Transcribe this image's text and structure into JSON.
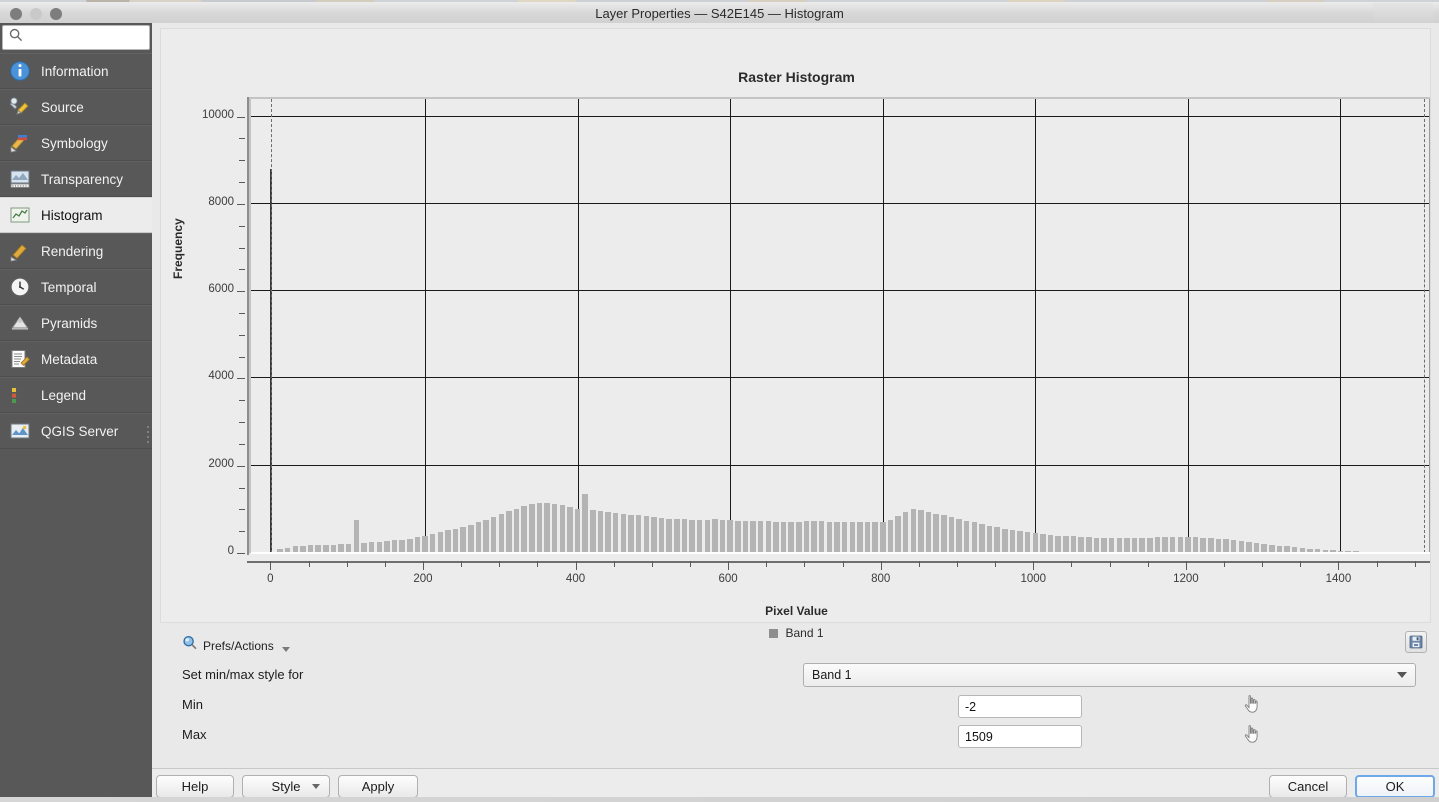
{
  "window": {
    "title": "Layer Properties — S42E145 — Histogram",
    "controls": [
      "close",
      "minimize",
      "maximize"
    ]
  },
  "sidebar": {
    "search": {
      "value": "",
      "placeholder": ""
    },
    "items": [
      {
        "label": "Information",
        "icon": "info-icon",
        "active": false
      },
      {
        "label": "Source",
        "icon": "source-icon",
        "active": false
      },
      {
        "label": "Symbology",
        "icon": "symbology-icon",
        "active": false
      },
      {
        "label": "Transparency",
        "icon": "transparency-icon",
        "active": false
      },
      {
        "label": "Histogram",
        "icon": "histogram-icon",
        "active": true
      },
      {
        "label": "Rendering",
        "icon": "rendering-icon",
        "active": false
      },
      {
        "label": "Temporal",
        "icon": "temporal-icon",
        "active": false
      },
      {
        "label": "Pyramids",
        "icon": "pyramids-icon",
        "active": false
      },
      {
        "label": "Metadata",
        "icon": "metadata-icon",
        "active": false
      },
      {
        "label": "Legend",
        "icon": "legend-icon",
        "active": false
      },
      {
        "label": "QGIS Server",
        "icon": "qgis-server-icon",
        "active": false
      }
    ]
  },
  "controls": {
    "prefs_actions_label": "Prefs/Actions",
    "save_icon": "save-icon",
    "set_minmax_label": "Set min/max style for",
    "band_selector": {
      "value": "Band 1",
      "options": [
        "Band 1"
      ]
    },
    "min_label": "Min",
    "min_value": "-2",
    "max_label": "Max",
    "max_value": "1509",
    "picker_icon": "pointer-hand-icon"
  },
  "buttons": {
    "help": "Help",
    "style": "Style",
    "apply": "Apply",
    "cancel": "Cancel",
    "ok": "OK"
  },
  "colors": {
    "bar": "#b4b4b4",
    "bar_dark": "#3a3a3a",
    "grid": "#1a1a1a",
    "plot_bg": "#ececec",
    "sidebar_bg": "#585858",
    "accent": "#6fa8e8",
    "legend_swatch": "#8e8e8e"
  },
  "chart_data": {
    "type": "bar",
    "title": "Raster Histogram",
    "xlabel": "Pixel Value",
    "ylabel": "Frequency",
    "xlim": [
      -28,
      1520
    ],
    "ylim": [
      0,
      10450
    ],
    "grid": true,
    "legend_position": "bottom",
    "legend": [
      "Band 1"
    ],
    "x_ticks": [
      0,
      200,
      400,
      600,
      800,
      1000,
      1200,
      1400
    ],
    "x_minor_step": 50,
    "y_ticks": [
      0,
      2000,
      4000,
      6000,
      8000,
      10000
    ],
    "y_minor_step": 500,
    "markers": [
      {
        "name": "min-marker",
        "x": -2,
        "style": "dashed"
      },
      {
        "name": "max-marker",
        "x": 1509,
        "style": "dashed"
      }
    ],
    "series": [
      {
        "name": "Band 1",
        "bin_width": 10,
        "x": [
          0,
          10,
          20,
          30,
          40,
          50,
          60,
          70,
          80,
          90,
          100,
          110,
          120,
          130,
          140,
          150,
          160,
          170,
          180,
          190,
          200,
          210,
          220,
          230,
          240,
          250,
          260,
          270,
          280,
          290,
          300,
          310,
          320,
          330,
          340,
          350,
          360,
          370,
          380,
          390,
          400,
          410,
          420,
          430,
          440,
          450,
          460,
          470,
          480,
          490,
          500,
          510,
          520,
          530,
          540,
          550,
          560,
          570,
          580,
          590,
          600,
          610,
          620,
          630,
          640,
          650,
          660,
          670,
          680,
          690,
          700,
          710,
          720,
          730,
          740,
          750,
          760,
          770,
          780,
          790,
          800,
          810,
          820,
          830,
          840,
          850,
          860,
          870,
          880,
          890,
          900,
          910,
          920,
          930,
          940,
          950,
          960,
          970,
          980,
          990,
          1000,
          1010,
          1020,
          1030,
          1040,
          1050,
          1060,
          1070,
          1080,
          1090,
          1100,
          1110,
          1120,
          1130,
          1140,
          1150,
          1160,
          1170,
          1180,
          1190,
          1200,
          1210,
          1220,
          1230,
          1240,
          1250,
          1260,
          1270,
          1280,
          1290,
          1300,
          1310,
          1320,
          1330,
          1340,
          1350,
          1360,
          1370,
          1380,
          1390,
          1400,
          1410,
          1420,
          1430,
          1440,
          1450,
          1460,
          1470,
          1480,
          1490,
          1500
        ],
        "values": [
          8800,
          95,
          120,
          150,
          165,
          180,
          175,
          195,
          185,
          200,
          210,
          760,
          230,
          250,
          245,
          270,
          290,
          300,
          330,
          360,
          400,
          430,
          480,
          520,
          560,
          600,
          640,
          700,
          760,
          830,
          900,
          960,
          1020,
          1080,
          1120,
          1150,
          1140,
          1130,
          1100,
          1060,
          1000,
          1350,
          980,
          960,
          940,
          920,
          900,
          880,
          860,
          840,
          820,
          800,
          790,
          780,
          770,
          760,
          750,
          760,
          770,
          760,
          750,
          745,
          740,
          735,
          730,
          725,
          720,
          715,
          715,
          720,
          730,
          735,
          730,
          720,
          715,
          710,
          705,
          700,
          700,
          700,
          720,
          760,
          850,
          950,
          1000,
          980,
          940,
          900,
          860,
          820,
          780,
          740,
          700,
          660,
          620,
          590,
          560,
          530,
          500,
          480,
          460,
          440,
          420,
          400,
          390,
          380,
          370,
          360,
          355,
          350,
          345,
          340,
          340,
          345,
          350,
          355,
          360,
          365,
          370,
          370,
          365,
          360,
          350,
          340,
          330,
          320,
          300,
          280,
          260,
          240,
          215,
          190,
          170,
          150,
          130,
          115,
          100,
          88,
          76,
          65,
          55,
          46,
          38,
          31,
          25,
          20,
          16,
          12,
          9,
          7,
          5,
          4,
          3,
          2
        ]
      }
    ]
  }
}
